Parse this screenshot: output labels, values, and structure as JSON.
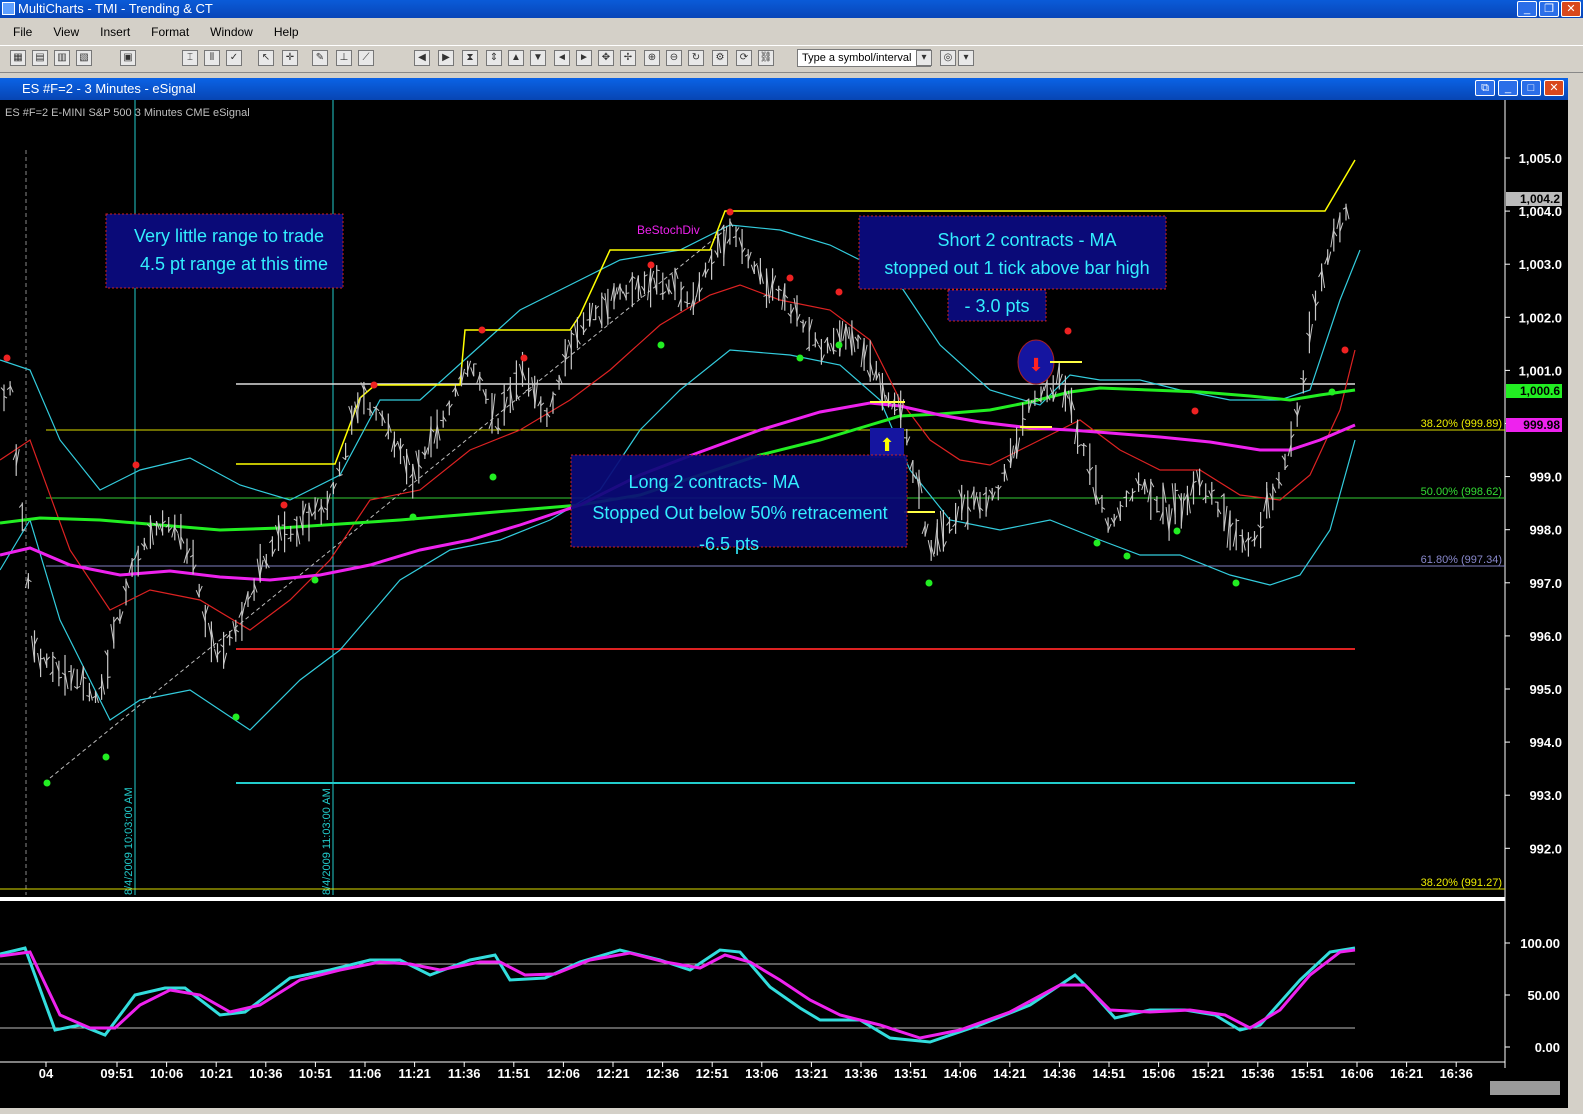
{
  "app": {
    "title": "MultiCharts - TMI - Trending & CT",
    "menu": [
      "File",
      "View",
      "Insert",
      "Format",
      "Window",
      "Help"
    ],
    "symbol_placeholder": "Type a symbol/interval"
  },
  "chart_window": {
    "title": "ES #F=2 - 3 Minutes - eSignal",
    "info_line": "ES #F=2  E-MINI S&P 500  3 Minutes  CME  eSignal"
  },
  "annotations": {
    "box1_line1": "Very little range to trade",
    "box1_line2": "4.5 pt range at this time",
    "box2_line1": "Short 2 contracts - MA",
    "box2_line2": "stopped out 1 tick above bar high",
    "box3": "- 3.0 pts",
    "box4_line1": "Long 2 contracts- MA",
    "box4_line2": "Stopped Out below 50% retracement",
    "box4_line3": "-6.5 pts",
    "divergence_label": "BeStochDiv",
    "vline1_label": "8/4/2009 10:03:00 AM",
    "vline2_label": "8/4/2009 11:03:00 AM"
  },
  "fib_labels": {
    "f1": "38.20% (999.89)",
    "f2": "50.00% (998.62)",
    "f3": "61.80% (997.34)",
    "f4": "38.20% (991.27)"
  },
  "price_axis": {
    "ticks": [
      "1,005.0",
      "1,004.0",
      "1,003.0",
      "1,002.0",
      "1,001.0",
      "1,000.0",
      "999.0",
      "998.0",
      "997.0",
      "996.0",
      "995.0",
      "994.0",
      "993.0",
      "992.0"
    ],
    "last_price": "1,004.2",
    "ma_price": "1,000.6",
    "ref_price": "999.98"
  },
  "osc_axis": {
    "ticks": [
      "100.00",
      "50.00",
      "0.00"
    ]
  },
  "time_axis": [
    "04",
    "09:51",
    "10:06",
    "10:21",
    "10:36",
    "10:51",
    "11:06",
    "11:21",
    "11:36",
    "11:51",
    "12:06",
    "12:21",
    "12:36",
    "12:51",
    "13:06",
    "13:21",
    "13:36",
    "13:51",
    "14:06",
    "14:21",
    "14:36",
    "14:51",
    "15:06",
    "15:21",
    "15:36",
    "15:51",
    "16:06",
    "16:21",
    "16:36"
  ],
  "colors": {
    "background": "#000000",
    "bars": "#c8c8c8",
    "fib_38": "#ffff00",
    "fib_50": "#33dd33",
    "fib_618": "#8080c0",
    "ma_green": "#22ee22",
    "ma_magenta": "#ee22ee",
    "band_cyan": "#33ccdd",
    "ma_red": "#dd2222",
    "annotation_box": "#0a0a78",
    "annotation_text": "#33eeff"
  }
}
